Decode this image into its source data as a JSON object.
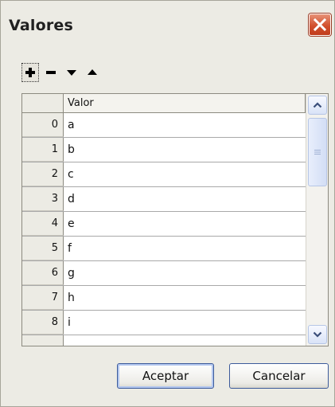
{
  "window": {
    "title": "Valores"
  },
  "toolbar": {
    "buttons": [
      {
        "icon": "plus-icon"
      },
      {
        "icon": "minus-icon"
      },
      {
        "icon": "arrow-down-icon"
      },
      {
        "icon": "arrow-up-icon"
      }
    ]
  },
  "table": {
    "column_header": "Valor",
    "rows": [
      {
        "index": "0",
        "value": "a"
      },
      {
        "index": "1",
        "value": "b"
      },
      {
        "index": "2",
        "value": "c"
      },
      {
        "index": "3",
        "value": "d"
      },
      {
        "index": "4",
        "value": "e"
      },
      {
        "index": "5",
        "value": "f"
      },
      {
        "index": "6",
        "value": "g"
      },
      {
        "index": "7",
        "value": "h"
      },
      {
        "index": "8",
        "value": "i"
      }
    ]
  },
  "buttons": {
    "accept": "Aceptar",
    "cancel": "Cancelar"
  },
  "colors": {
    "dialog_bg": "#ecebe4",
    "close_red": "#d2502d",
    "button_border": "#3c5a9a"
  }
}
